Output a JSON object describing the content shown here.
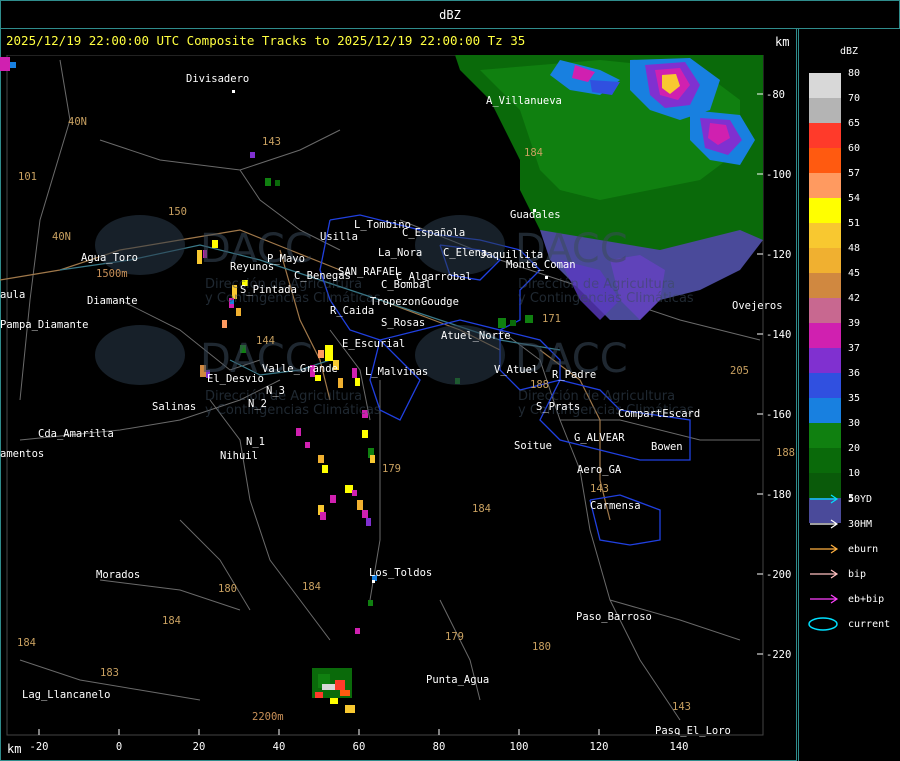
{
  "window": {
    "title": "dBZ"
  },
  "header": {
    "text": "2025/12/19 22:00:00 UTC Composite Tracks to 2025/12/19 22:00:00 Tz 35",
    "km_right": "km"
  },
  "axes": {
    "km_label": "km",
    "x_ticks": [
      "-20",
      "0",
      "20",
      "40",
      "60",
      "80",
      "100",
      "120",
      "140"
    ],
    "y_ticks": [
      "-80",
      "-100",
      "-120",
      "-140",
      "-160",
      "-180",
      "-200",
      "-220"
    ]
  },
  "legend": {
    "title": "dBZ",
    "levels": [
      {
        "label": "80",
        "color": "#d8d8d8"
      },
      {
        "label": "70",
        "color": "#b4b4b4"
      },
      {
        "label": "65",
        "color": "#ff3a2a"
      },
      {
        "label": "60",
        "color": "#ff5a10"
      },
      {
        "label": "57",
        "color": "#ff9a60"
      },
      {
        "label": "54",
        "color": "#ffff00"
      },
      {
        "label": "51",
        "color": "#f8c830"
      },
      {
        "label": "48",
        "color": "#f0b030"
      },
      {
        "label": "45",
        "color": "#d08840"
      },
      {
        "label": "42",
        "color": "#c86890"
      },
      {
        "label": "39",
        "color": "#d020b0"
      },
      {
        "label": "37",
        "color": "#8030d0"
      },
      {
        "label": "36",
        "color": "#3050e0"
      },
      {
        "label": "35",
        "color": "#1880e0"
      },
      {
        "label": "30",
        "color": "#108010"
      },
      {
        "label": "20",
        "color": "#0a6a0a"
      },
      {
        "label": "10",
        "color": "#0a5a0a"
      },
      {
        "label": "5",
        "color": "#4a4a9a"
      }
    ],
    "tracks": [
      {
        "label": "50YD",
        "color": "#00e0ff"
      },
      {
        "label": "30HM",
        "color": "#ffffff"
      },
      {
        "label": "eburn",
        "color": "#ffb040"
      },
      {
        "label": "bip",
        "color": "#ffc0c0"
      },
      {
        "label": "eb+bip",
        "color": "#ff40ff"
      },
      {
        "label": "current",
        "color": "#00e0ff"
      }
    ]
  },
  "places": [
    "Divisadero",
    "A_Villanueva",
    "Guadales",
    "L_Tombino",
    "Usilla",
    "C_Española",
    "La_Nora",
    "C_Elena",
    "Jaquillita",
    "C_Benegas",
    "SAN_RAFAEL",
    "C_Algarrobal",
    "C_Bombal",
    "Rama_Caida",
    "Tropezon",
    "Goudge",
    "R_Caida",
    "S_Rosas",
    "E_Escurial",
    "Atuel_Norte",
    "Valle_Grande",
    "L_Malvinas",
    "V_Atuel",
    "R_Padre",
    "El_Desvio",
    "Salinas",
    "N_2",
    "N_3",
    "N_1",
    "Nihuil",
    "S_Prats",
    "CompartEscard",
    "G_ALVEAR",
    "Soitue",
    "Bowen",
    "Aero_GA",
    "Carmensa",
    "Los_Toldos",
    "Morados",
    "Paso_Barroso",
    "Punta_Agua",
    "Lag_Llancanelo",
    "Paso_El_Loro",
    "Agua_Toro",
    "Reyunos",
    "P_Mayo",
    "S_Pintada",
    "Pampa_Diamante",
    "Cda_Amarilla",
    "amentos",
    "aula",
    "Diamante",
    "Ovejeros",
    "Monte_Coman"
  ],
  "routes": [
    "40N",
    "101",
    "143",
    "150",
    "144",
    "179",
    "184",
    "180",
    "183",
    "171",
    "40N",
    "205",
    "188"
  ],
  "elevations": [
    "1500m",
    "2200m"
  ],
  "watermarks": [
    "DACC",
    "Dirección de Agricultura",
    "y Contingencias Climáticas"
  ]
}
